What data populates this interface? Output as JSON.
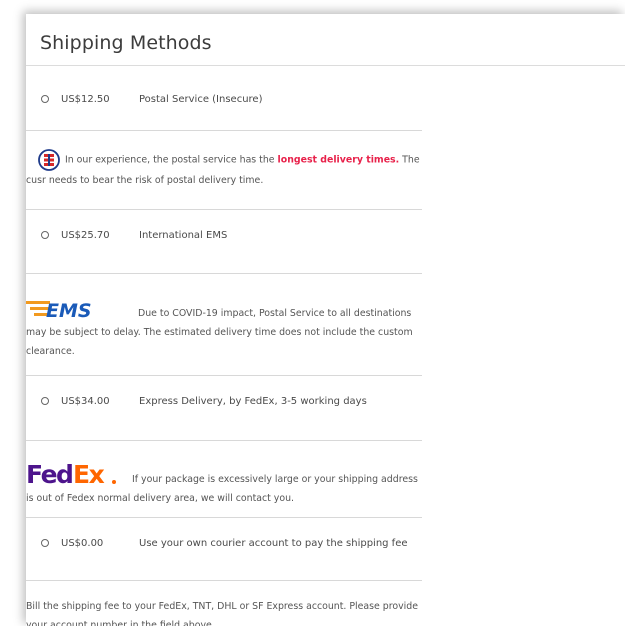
{
  "title": "Shipping Methods",
  "options": [
    {
      "price": "US$12.50",
      "label": "Postal Service (Insecure)",
      "note_before": "In our experience, the postal service has the ",
      "note_highlight": "longest delivery times.",
      "note_after": " The cusr needs to bear the risk of postal delivery time."
    },
    {
      "price": "US$25.70",
      "label": "International EMS",
      "note_line1": "Due to COVID-19 impact, Postal Service to all destinations",
      "note_rest": "may be subject to delay. The estimated delivery time does not include the custom clearance."
    },
    {
      "price": "US$34.00",
      "label": "Express Delivery, by FedEx, 3-5 working days",
      "note_line1": "If your package is excessively large or your shipping address",
      "note_rest": "is out of Fedex normal delivery area, we will contact you."
    },
    {
      "price": "US$0.00",
      "label": "Use your own courier account to pay the shipping fee",
      "note": "Bill the shipping fee to your FedEx, TNT, DHL or SF Express account. Please provide your account number in the field above."
    }
  ],
  "logos": {
    "postal": "postal-service-logo",
    "ems": "EMS",
    "fedex_fed": "Fed",
    "fedex_ex": "Ex"
  },
  "colors": {
    "highlight": "#e8214a",
    "postal_blue": "#1e3a8a",
    "postal_red": "#d62828",
    "ems_blue": "#1a5ab8",
    "ems_orange": "#f29a1f",
    "fedex_purple": "#4d148c",
    "fedex_orange": "#ff6600"
  }
}
